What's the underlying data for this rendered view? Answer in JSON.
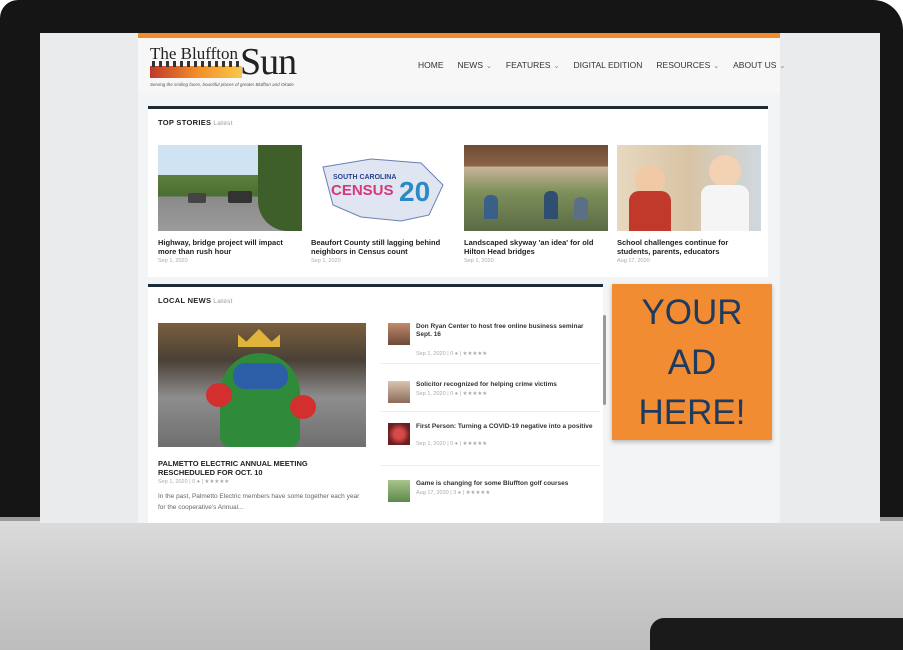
{
  "site": {
    "logo": {
      "word1": "The Bluffton",
      "word2": "Sun",
      "tagline": "Serving the smiling faces, bountiful places of greater Bluffton and Okatie"
    },
    "nav": [
      {
        "label": "HOME",
        "dropdown": false
      },
      {
        "label": "NEWS",
        "dropdown": true
      },
      {
        "label": "FEATURES",
        "dropdown": true
      },
      {
        "label": "DIGITAL EDITION",
        "dropdown": false
      },
      {
        "label": "RESOURCES",
        "dropdown": true
      },
      {
        "label": "ABOUT US",
        "dropdown": true
      }
    ],
    "chevron": "⌄",
    "colors": {
      "accent": "#f28c28",
      "section_border": "#1c2b36",
      "ad_bg": "#f28c33",
      "ad_text": "#1e3a5f"
    }
  },
  "top_stories": {
    "title": "TOP STORIES",
    "latest": "Latest",
    "cards": [
      {
        "title": "Highway, bridge project will impact more than rush hour",
        "date": "Sep 1, 2020",
        "image": "road-traffic-photo"
      },
      {
        "title": "Beaufort County still lagging behind neighbors in Census count",
        "date": "Sep 1, 2020",
        "image": "census-logo",
        "census_line1": "SOUTH CAROLINA",
        "census_line2": "CENSUS",
        "census_year": "20"
      },
      {
        "title": "Landscaped skyway 'an idea' for old Hilton Head bridges",
        "date": "Sep 1, 2020",
        "image": "pavilion-photo"
      },
      {
        "title": "School challenges continue for students, parents, educators",
        "date": "Aug 17, 2020",
        "image": "classroom-photo"
      }
    ]
  },
  "local_news": {
    "title": "LOCAL NEWS",
    "latest": "Latest",
    "featured": {
      "title": "PALMETTO ELECTRIC ANNUAL MEETING RESCHEDULED FOR OCT. 10",
      "meta": "Sep 1, 2020 | 0 ● | ★★★★★",
      "excerpt": "In the past, Palmetto Electric members have some together each year for the cooperative's Annual..."
    },
    "items": [
      {
        "title": "Don Ryan Center to host free online business seminar Sept. 16",
        "meta": "Sep 1, 2020 | 0 ● | ★★★★★"
      },
      {
        "title": "Solicitor recognized for helping crime victims",
        "meta": "Sep 1, 2020 | 0 ● | ★★★★★"
      },
      {
        "title": "First Person: Turning a COVID-19 negative into a positive",
        "meta": "Sep 1, 2020 | 0 ● | ★★★★★"
      },
      {
        "title": "Game is changing for some Bluffton golf courses",
        "meta": "Aug 17, 2020 | 3 ● | ★★★★★"
      }
    ]
  },
  "ad": {
    "line1": "YOUR",
    "line2": "AD",
    "line3": "HERE!"
  }
}
